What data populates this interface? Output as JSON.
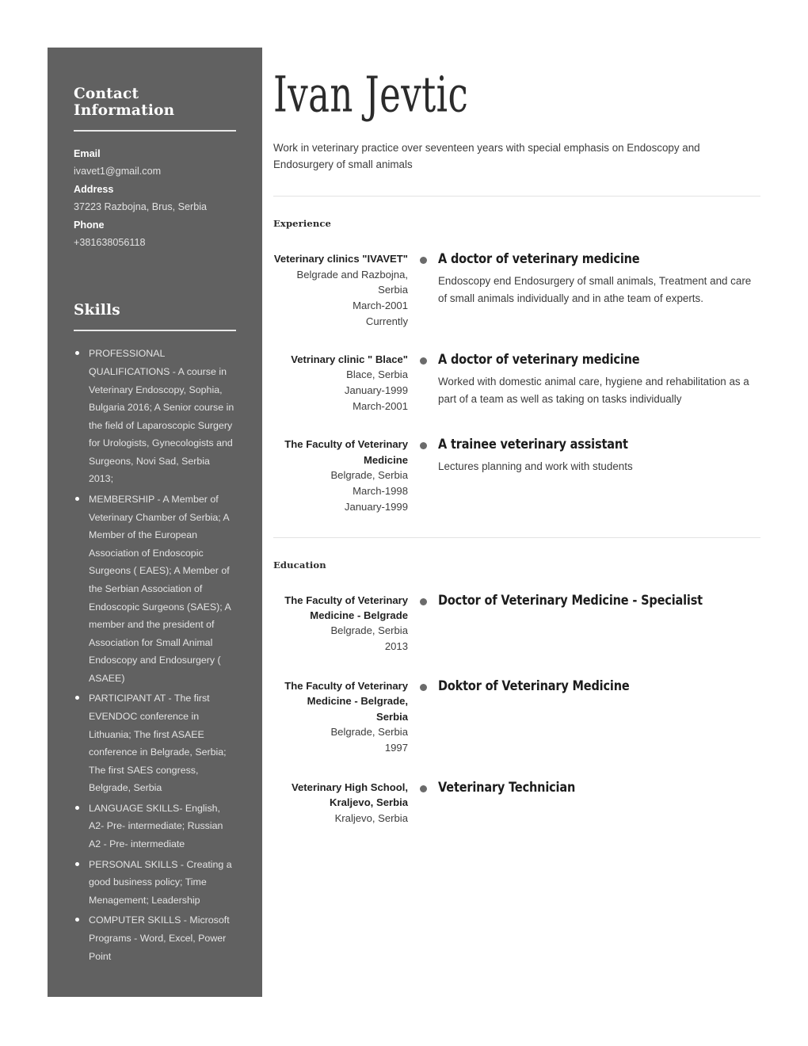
{
  "colors": {
    "sidebar_bg": "#616161",
    "page_bg": "#ffffff",
    "text_dark": "#2b2b2b",
    "bullet_dot": "#6b6b6b"
  },
  "sidebar": {
    "contact_heading": "Contact Information",
    "contact": [
      {
        "label": "Email",
        "value": "ivavet1@gmail.com"
      },
      {
        "label": "Address",
        "value": "37223 Razbojna, Brus, Serbia"
      },
      {
        "label": "Phone",
        "value": "+381638056118"
      }
    ],
    "skills_heading": "Skills",
    "skills": [
      "PROFESSIONAL QUALIFICATIONS - A course in Veterinary Endoscopy, Sophia, Bulgaria 2016; A Senior course in the field of Laparoscopic Surgery for Urologists, Gynecologists and Surgeons, Novi Sad, Serbia 2013;",
      "MEMBERSHIP - A Member of Veterinary Chamber of Serbia; A Member of the European Association of Endoscopic Surgeons ( EAES); A Member of the Serbian Association of Endoscopic Surgeons (SAES); A member and the president of Association for Small Animal Endoscopy and Endosurgery ( ASAEE)",
      "PARTICIPANT AT - The first EVENDOC conference in Lithuania; The first ASAEE conference in Belgrade, Serbia; The first SAES congress, Belgrade, Serbia",
      "LANGUAGE SKILLS- English, A2- Pre- intermediate; Russian A2 - Pre- intermediate",
      "PERSONAL SKILLS - Creating a good business policy; Time Menagement; Leadership",
      "COMPUTER SKILLS - Microsoft Programs - Word, Excel, Power Point"
    ]
  },
  "header": {
    "name": "Ivan Jevtic",
    "summary": "Work in veterinary practice over seventeen years with special emphasis on Endoscopy and Endosurgery of small animals"
  },
  "experience": {
    "section_title": "Experience",
    "entries": [
      {
        "org": "Veterinary clinics \"IVAVET\"",
        "location": "Belgrade and Razbojna, Serbia",
        "start": "March-2001",
        "end": "Currently",
        "role": "A doctor of veterinary medicine",
        "description": "Endoscopy end Endosurgery of small animals, Treatment and care of small animals individually and in athe team of experts."
      },
      {
        "org": "Vetrinary clinic \" Blace\"",
        "location": "Blace, Serbia",
        "start": "January-1999",
        "end": "March-2001",
        "role": "A doctor of veterinary medicine",
        "description": "Worked with domestic animal care, hygiene and rehabilitation as a part of a team as well as taking on tasks individually"
      },
      {
        "org": "The Faculty of Veterinary Medicine",
        "location": "Belgrade, Serbia",
        "start": "March-1998",
        "end": "January-1999",
        "role": "A trainee veterinary assistant",
        "description": "Lectures planning and work with students"
      }
    ]
  },
  "education": {
    "section_title": "Education",
    "entries": [
      {
        "org": "The Faculty of Veterinary Medicine - Belgrade",
        "location": "Belgrade, Serbia",
        "start": "2013",
        "end": "",
        "role": "Doctor of Veterinary Medicine - Specialist",
        "description": ""
      },
      {
        "org": "The Faculty of Veterinary Medicine - Belgrade, Serbia",
        "location": "Belgrade, Serbia",
        "start": "1997",
        "end": "",
        "role": "Doktor of Veterinary Medicine",
        "description": ""
      },
      {
        "org": "Veterinary High School, Kraljevo, Serbia",
        "location": "Kraljevo, Serbia",
        "start": "",
        "end": "",
        "role": "Veterinary Technician",
        "description": ""
      }
    ]
  }
}
